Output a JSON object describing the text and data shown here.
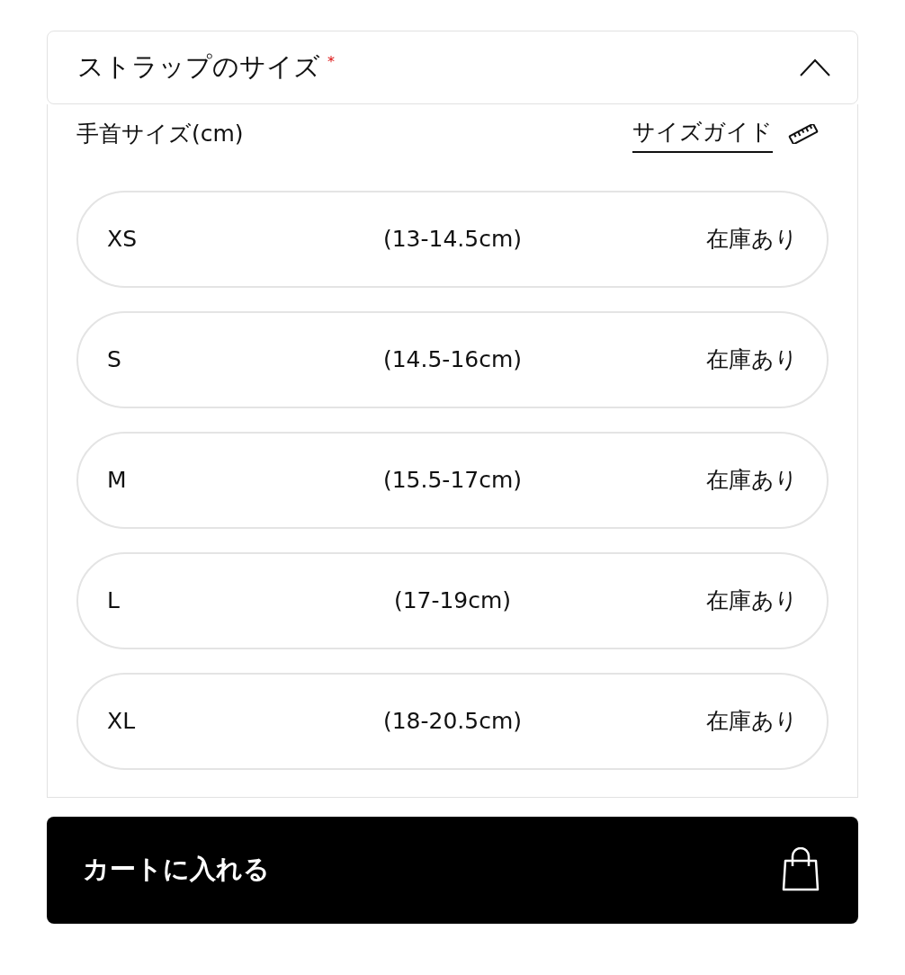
{
  "section": {
    "title": "ストラップのサイズ",
    "required_mark": "*",
    "expanded": true
  },
  "subheader": {
    "label": "手首サイズ(cm)",
    "guide_link": "サイズガイド"
  },
  "options": [
    {
      "size": "XS",
      "range": "(13-14.5cm)",
      "stock": "在庫あり",
      "selected": false
    },
    {
      "size": "S",
      "range": "(14.5-16cm)",
      "stock": "在庫あり",
      "selected": false
    },
    {
      "size": "M",
      "range": "(15.5-17cm)",
      "stock": "在庫あり",
      "selected": false
    },
    {
      "size": "L",
      "range": "(17-19cm)",
      "stock": "在庫あり",
      "selected": false
    },
    {
      "size": "XL",
      "range": "(18-20.5cm)",
      "stock": "在庫あり",
      "selected": false
    }
  ],
  "cart_button": {
    "label": "カートに入れる"
  }
}
